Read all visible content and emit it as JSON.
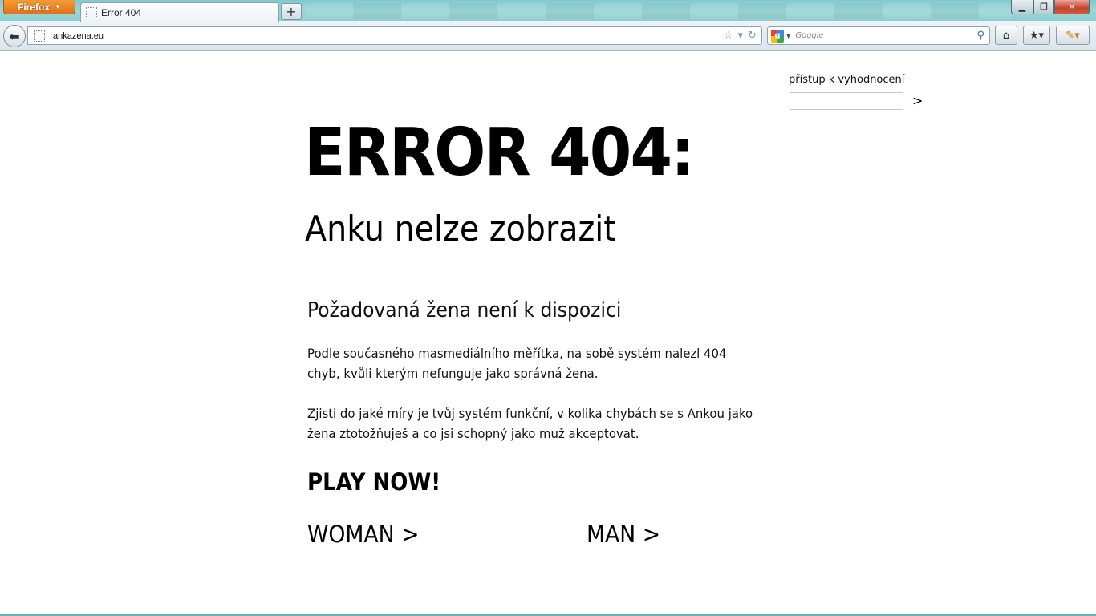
{
  "browser": {
    "app_button_label": "Firefox",
    "tab_title": "Error 404",
    "new_tab_label": "+",
    "url": "ankazena.eu",
    "search_placeholder": "Google",
    "window_controls": {
      "minimize": "▁",
      "maximize": "❐",
      "close": "✕"
    }
  },
  "page": {
    "access": {
      "label": "přístup k vyhodnocení",
      "submit": ">"
    },
    "title": "ERROR 404:",
    "subtitle": "Anku nelze zobrazit",
    "heading": "Požadovaná žena není k dispozici",
    "paragraph1": "Podle současného masmediálního měřítka, na sobě systém nalezl 404 chyb, kvůli kterým nefunguje jako správná žena.",
    "paragraph2": "Zjisti do jaké míry je tvůj systém funkční, v kolika chybách se s Ankou jako žena ztotožňuješ a co jsi schopný jako muž akceptovat.",
    "play_now": "PLAY NOW!",
    "choices": {
      "woman": "WOMAN >",
      "man": "MAN >"
    }
  },
  "colors": {
    "titlebar": "#8ccfd1",
    "firefox_orange": "#e1731a",
    "text": "#000000"
  }
}
